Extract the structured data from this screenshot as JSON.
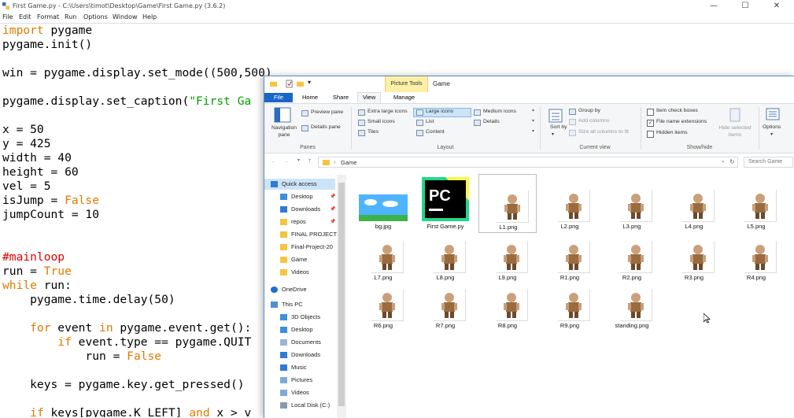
{
  "idle": {
    "title": "First Game.py - C:\\Users\\timot\\Desktop\\Game\\First Game.py (3.6.2)",
    "menu": [
      "File",
      "Edit",
      "Format",
      "Run",
      "Options",
      "Window",
      "Help"
    ],
    "window_controls": [
      "—",
      "☐",
      "✕"
    ],
    "code_lines": [
      {
        "parts": [
          {
            "t": "import",
            "c": "kw"
          },
          {
            "t": " pygame",
            "c": ""
          }
        ]
      },
      {
        "parts": [
          {
            "t": "pygame.init()",
            "c": ""
          }
        ]
      },
      {
        "parts": []
      },
      {
        "parts": [
          {
            "t": "win = pygame.display.set_mode((500,500))",
            "c": ""
          }
        ]
      },
      {
        "parts": []
      },
      {
        "parts": [
          {
            "t": "pygame.display.set_caption(",
            "c": ""
          },
          {
            "t": "\"First Ga",
            "c": "str"
          }
        ]
      },
      {
        "parts": []
      },
      {
        "parts": [
          {
            "t": "x = 50",
            "c": ""
          }
        ]
      },
      {
        "parts": [
          {
            "t": "y = 425",
            "c": ""
          }
        ]
      },
      {
        "parts": [
          {
            "t": "width = 40",
            "c": ""
          }
        ]
      },
      {
        "parts": [
          {
            "t": "height = 60",
            "c": ""
          }
        ]
      },
      {
        "parts": [
          {
            "t": "vel = 5",
            "c": ""
          }
        ]
      },
      {
        "parts": [
          {
            "t": "isJump = ",
            "c": ""
          },
          {
            "t": "False",
            "c": "kw"
          }
        ]
      },
      {
        "parts": [
          {
            "t": "jumpCount = 10",
            "c": ""
          }
        ]
      },
      {
        "parts": []
      },
      {
        "parts": []
      },
      {
        "parts": [
          {
            "t": "#mainloop",
            "c": "cmt"
          }
        ]
      },
      {
        "parts": [
          {
            "t": "run = ",
            "c": ""
          },
          {
            "t": "True",
            "c": "kw"
          }
        ]
      },
      {
        "parts": [
          {
            "t": "while",
            "c": "kw"
          },
          {
            "t": " run:",
            "c": ""
          }
        ]
      },
      {
        "parts": [
          {
            "t": "    pygame.time.delay(50)",
            "c": ""
          }
        ]
      },
      {
        "parts": []
      },
      {
        "parts": [
          {
            "t": "    ",
            "c": ""
          },
          {
            "t": "for",
            "c": "kw"
          },
          {
            "t": " event ",
            "c": ""
          },
          {
            "t": "in",
            "c": "kw"
          },
          {
            "t": " pygame.event.get():",
            "c": ""
          }
        ]
      },
      {
        "parts": [
          {
            "t": "        ",
            "c": ""
          },
          {
            "t": "if",
            "c": "kw"
          },
          {
            "t": " event.type == pygame.QUIT",
            "c": ""
          }
        ]
      },
      {
        "parts": [
          {
            "t": "            run = ",
            "c": ""
          },
          {
            "t": "False",
            "c": "kw"
          }
        ]
      },
      {
        "parts": []
      },
      {
        "parts": [
          {
            "t": "    keys = pygame.key.get_pressed()",
            "c": ""
          }
        ]
      },
      {
        "parts": []
      },
      {
        "parts": [
          {
            "t": "    ",
            "c": ""
          },
          {
            "t": "if",
            "c": "kw"
          },
          {
            "t": " keys[pygame.K_LEFT] ",
            "c": ""
          },
          {
            "t": "and",
            "c": "kw"
          },
          {
            "t": " x > v",
            "c": ""
          }
        ]
      }
    ]
  },
  "explorer": {
    "context_tab": "Picture Tools",
    "window_title": "Game",
    "tabs": {
      "file": "File",
      "home": "Home",
      "share": "Share",
      "view": "View",
      "manage": "Manage"
    },
    "ribbon": {
      "panes": {
        "navigation": "Navigation pane",
        "preview": "Preview pane",
        "details": "Details pane",
        "group": "Panes"
      },
      "layout": {
        "extra_large": "Extra large icons",
        "large": "Large icons",
        "medium": "Medium icons",
        "small": "Small icons",
        "list": "List",
        "details": "Details",
        "tiles": "Tiles",
        "content": "Content",
        "group": "Layout"
      },
      "current_view": {
        "sort_by": "Sort by",
        "group_by": "Group by",
        "add_columns": "Add columns",
        "size_all": "Size all columns to fit",
        "group": "Current view"
      },
      "show_hide": {
        "item_check_boxes": "Item check boxes",
        "file_name_extensions": "File name extensions",
        "hidden_items": "Hidden items",
        "hide_selected": "Hide selected items",
        "group": "Show/hide"
      },
      "options": "Options",
      "checks": {
        "item_check_boxes": false,
        "file_name_extensions": true,
        "hidden_items": false
      }
    },
    "address": {
      "path": "Game",
      "search_placeholder": "Search Game"
    },
    "nav": {
      "quick_access": "Quick access",
      "items": [
        "Desktop",
        "Downloads",
        "repos",
        "FINAL PROJECT",
        "Final-Project-20",
        "Game",
        "Videos"
      ],
      "onedrive": "OneDrive",
      "this_pc": "This PC",
      "pc_items": [
        "3D Objects",
        "Desktop",
        "Documents",
        "Downloads",
        "Music",
        "Pictures",
        "Videos",
        "Local Disk (C:)"
      ]
    },
    "files": [
      "bg.jpg",
      "First Game.py",
      "L1.png",
      "L2.png",
      "L3.png",
      "L4.png",
      "L5.png",
      "L7.png",
      "L8.png",
      "L9.png",
      "R1.png",
      "R2.png",
      "R3.png",
      "R4.png",
      "R6.png",
      "R7.png",
      "R8.png",
      "R9.png",
      "standing.png"
    ],
    "pycharm_logo": "PC",
    "colors": {
      "file_tab": "#1a66c7",
      "context_tab": "#fcefa6",
      "selection": "#cce4f7"
    }
  }
}
